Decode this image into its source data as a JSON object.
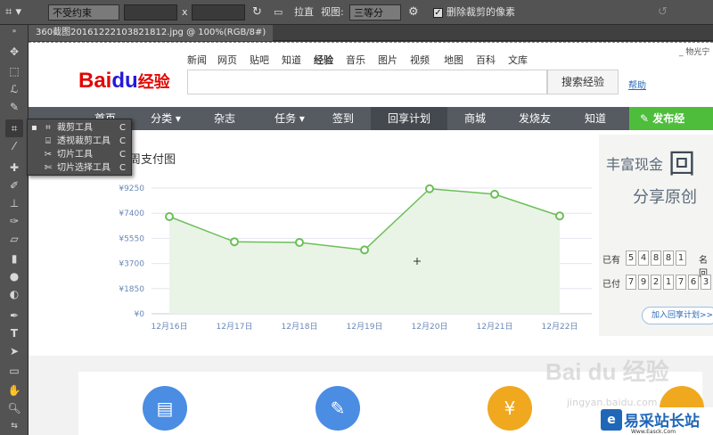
{
  "options_bar": {
    "ratio_select": "不受约束",
    "x_sep": "x",
    "straighten_label": "拉直",
    "view_label": "视图:",
    "view_select": "三等分",
    "delete_cropped_label": "删除裁剪的像素",
    "delete_cropped_checked": true
  },
  "document_tab": {
    "title": "360截图20161222103821812.jpg @ 100%(RGB/8#)"
  },
  "toolbar": {
    "tools": [
      "move",
      "marquee",
      "lasso",
      "quick-select",
      "crop",
      "eyedropper",
      "spot-heal",
      "brush",
      "stamp",
      "history-brush",
      "eraser",
      "gradient",
      "blur",
      "dodge",
      "pen",
      "type",
      "path-select",
      "shape",
      "hand",
      "zoom"
    ]
  },
  "flyout": {
    "items": [
      {
        "label": "裁剪工具",
        "key": "C",
        "selected": true
      },
      {
        "label": "透视裁剪工具",
        "key": "C",
        "selected": false
      },
      {
        "label": "切片工具",
        "key": "C",
        "selected": false
      },
      {
        "label": "切片选择工具",
        "key": "C",
        "selected": false
      }
    ]
  },
  "web": {
    "logo_bai": "Bai",
    "logo_du": "du",
    "logo_jy": "经验",
    "top_links": [
      "新闻",
      "网页",
      "贴吧",
      "知道",
      "经验",
      "音乐",
      "图片",
      "视频",
      "地图",
      "百科",
      "文库"
    ],
    "search_button": "搜索经验",
    "help": "帮助",
    "top_right": "_ 物光宁",
    "nav": [
      "首页",
      "分类",
      "杂志",
      "任务",
      "签到",
      "回享计划",
      "商城",
      "发烧友",
      "知道"
    ],
    "nav_selected": 5,
    "nav_green": "发布经",
    "chart_title": "一周支付图",
    "right_panel": {
      "ad_line1": "丰富现金",
      "ad_big": "回",
      "ad_line2": "分享原创",
      "row1_label": "已有",
      "row1_digits": [
        "5",
        "4",
        "8",
        "8",
        "1"
      ],
      "row1_suffix": "名回",
      "row2_label": "已付",
      "row2_digits": [
        "7",
        "9",
        "2",
        "1",
        "7",
        "6",
        "3"
      ],
      "button": "加入回享计划>>"
    },
    "watermark": "Bai du 经验",
    "watermark_sub": "jingyan.baidu.com",
    "site_name": "易采站长站",
    "site_url": "Www.Easck.Com"
  },
  "chart_data": {
    "type": "area",
    "title": "一周支付图",
    "categories": [
      "12月16日",
      "12月17日",
      "12月18日",
      "12月19日",
      "12月20日",
      "12月21日",
      "12月22日"
    ],
    "values": [
      7150,
      5300,
      5250,
      4700,
      9200,
      8800,
      7200
    ],
    "y_ticks": [
      "¥0",
      "¥1850",
      "¥3700",
      "¥5550",
      "¥7400",
      "¥9250"
    ],
    "y_tick_values": [
      0,
      1850,
      3700,
      5550,
      7400,
      9250
    ],
    "ylim": [
      0,
      9250
    ],
    "line_color": "#6cbf5a",
    "fill_color": "#e9f4e6",
    "grid": true
  }
}
